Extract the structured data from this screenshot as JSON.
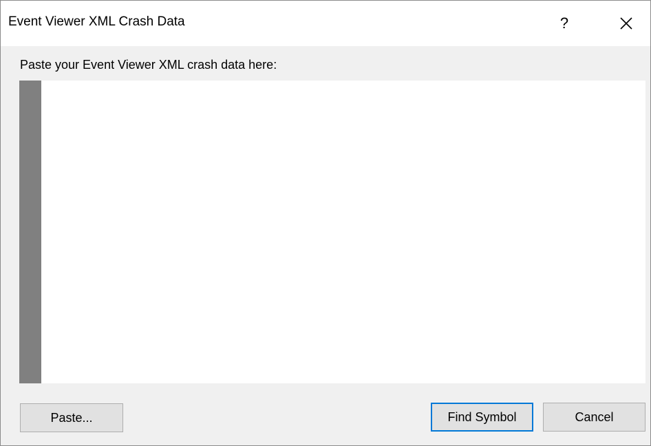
{
  "window": {
    "title": "Event Viewer XML Crash Data"
  },
  "titlebar": {
    "help_glyph": "?",
    "help_icon": "question-mark-icon",
    "close_icon": "close-x-icon"
  },
  "main": {
    "prompt_label": "Paste your Event Viewer XML crash data here:",
    "xml_input_value": ""
  },
  "buttons": {
    "paste_label": "Paste...",
    "find_symbol_label": "Find Symbol",
    "cancel_label": "Cancel"
  },
  "colors": {
    "accent": "#0078d7",
    "gutter": "#808080",
    "dialog_bg": "#f0f0f0",
    "button_bg": "#e1e1e1"
  }
}
